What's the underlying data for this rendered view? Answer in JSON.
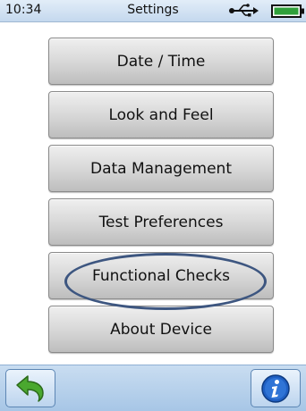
{
  "status_bar": {
    "time": "10:34",
    "title": "Settings",
    "icons": [
      "usb-icon",
      "battery-icon"
    ]
  },
  "menu": {
    "items": [
      {
        "label": "Date / Time"
      },
      {
        "label": "Look and Feel"
      },
      {
        "label": "Data Management"
      },
      {
        "label": "Test Preferences"
      },
      {
        "label": "Functional Checks",
        "highlighted": true
      },
      {
        "label": "About Device"
      }
    ]
  },
  "bottom_bar": {
    "icons": [
      "back-arrow-icon",
      "info-icon"
    ]
  },
  "colors": {
    "status_bar": "#c4d8ee",
    "button_face": "#d6d6d6",
    "highlight_ring": "#3d5680",
    "back_arrow": "#4aa82f",
    "info_icon": "#1f5fc2"
  }
}
